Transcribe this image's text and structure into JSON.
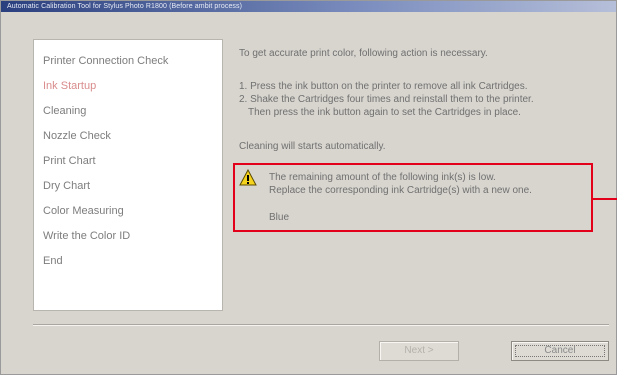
{
  "window": {
    "title": "Automatic Calibration Tool for Stylus Photo R1800 (Before ambit process)"
  },
  "sidebar": {
    "items": [
      {
        "label": "Printer Connection Check",
        "active": false
      },
      {
        "label": "Ink Startup",
        "active": true
      },
      {
        "label": "Cleaning",
        "active": false
      },
      {
        "label": "Nozzle Check",
        "active": false
      },
      {
        "label": "Print Chart",
        "active": false
      },
      {
        "label": "Dry Chart",
        "active": false
      },
      {
        "label": "Color Measuring",
        "active": false
      },
      {
        "label": "Write the Color ID",
        "active": false
      },
      {
        "label": "End",
        "active": false
      }
    ]
  },
  "main": {
    "intro": "To get accurate print color, following action is necessary.",
    "step1": "1. Press the ink button on the printer to remove all ink Cartridges.",
    "step2a": "2. Shake the Cartridges four times and reinstall them to the printer.",
    "step2b": "Then press the ink button again to set the Cartridges in place.",
    "cleaning_note": "Cleaning will starts automatically."
  },
  "alert": {
    "icon": "warning-icon",
    "line1": "The remaining amount of the following ink(s) is low.",
    "line2": "Replace the corresponding ink Cartridge(s) with a new one.",
    "ink": "Blue"
  },
  "footer": {
    "next_label": "Next >",
    "cancel_label": "Cancel"
  },
  "colors": {
    "highlight": "#e2001a",
    "active_item": "#d98c8c",
    "title_bar": "#2a3f7e"
  }
}
